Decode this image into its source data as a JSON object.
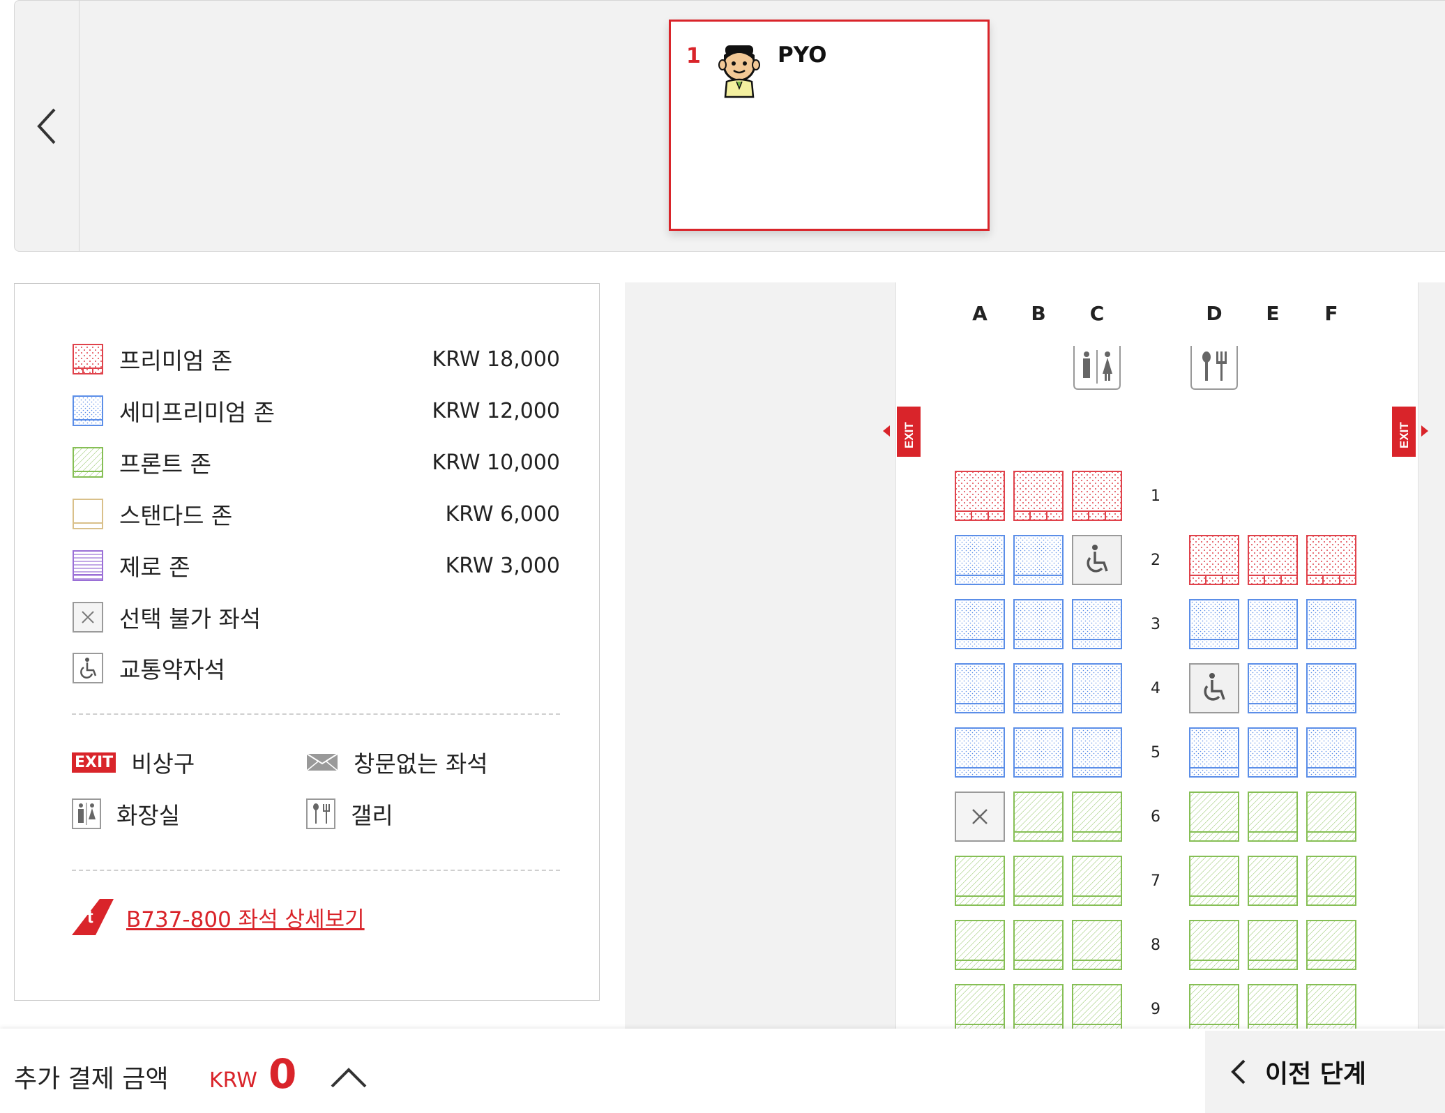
{
  "passengers": [
    {
      "number": "1",
      "name": "PYO"
    }
  ],
  "legend": {
    "zones": [
      {
        "label": "프리미엄 존",
        "price": "KRW 18,000"
      },
      {
        "label": "세미프리미엄 존",
        "price": "KRW 12,000"
      },
      {
        "label": "프론트 존",
        "price": "KRW 10,000"
      },
      {
        "label": "스탠다드 존",
        "price": "KRW 6,000"
      },
      {
        "label": "제로 존",
        "price": "KRW 3,000"
      }
    ],
    "unavailable_label": "선택 불가 좌석",
    "accessible_label": "교통약자석",
    "exit_badge": "EXIT",
    "exit_label": "비상구",
    "no_window_label": "창문없는 좌석",
    "lavatory_label": "화장실",
    "galley_label": "갤리",
    "aircraft_link": "B737-800 좌석 상세보기"
  },
  "seatmap": {
    "columns": [
      "A",
      "B",
      "C",
      "D",
      "E",
      "F"
    ],
    "exit_label": "EXIT",
    "rows": [
      {
        "num": "1",
        "seats": [
          "premium",
          "premium",
          "premium",
          null,
          null,
          null
        ]
      },
      {
        "num": "2",
        "seats": [
          "semi",
          "semi",
          "accessible",
          "premium",
          "premium",
          "premium"
        ]
      },
      {
        "num": "3",
        "seats": [
          "semi",
          "semi",
          "semi",
          "semi",
          "semi",
          "semi"
        ]
      },
      {
        "num": "4",
        "seats": [
          "semi",
          "semi",
          "semi",
          "accessible",
          "semi",
          "semi"
        ]
      },
      {
        "num": "5",
        "seats": [
          "semi",
          "semi",
          "semi",
          "semi",
          "semi",
          "semi"
        ]
      },
      {
        "num": "6",
        "seats": [
          "unavailable",
          "front",
          "front",
          "front",
          "front",
          "front"
        ]
      },
      {
        "num": "7",
        "seats": [
          "front",
          "front",
          "front",
          "front",
          "front",
          "front"
        ]
      },
      {
        "num": "8",
        "seats": [
          "front",
          "front",
          "front",
          "front",
          "front",
          "front"
        ]
      },
      {
        "num": "9",
        "seats": [
          "front",
          "front",
          "front",
          "front",
          "front",
          "front"
        ]
      }
    ]
  },
  "footer": {
    "payment_label": "추가 결제 금액",
    "currency": "KRW",
    "amount": "0",
    "prev_step_label": "이전 단계"
  },
  "colors": {
    "accent": "#d9242a",
    "premium": "#e0424b",
    "semi": "#5b8ee8",
    "front": "#86bf55",
    "standard": "#d9c08a",
    "zero": "#9a6fd6",
    "unavailable": "#9a9a9a"
  }
}
